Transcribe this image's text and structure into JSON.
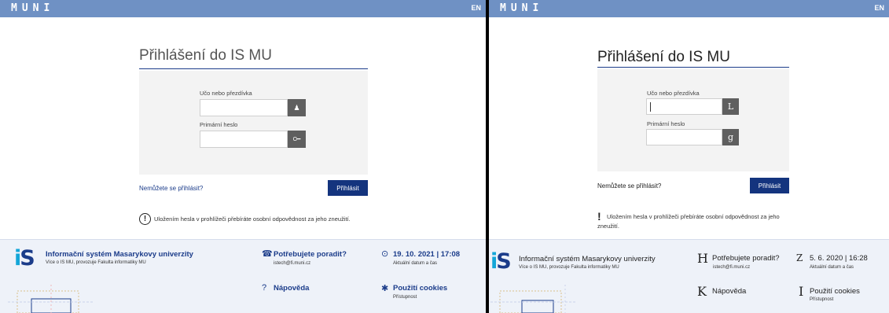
{
  "left": {
    "logo": "MUNI",
    "lang": "EN",
    "title": "Přihlášení do IS MU",
    "uco_label": "Učo nebo přezdívka",
    "uco_value": "",
    "uco_icon": "user-icon",
    "uco_icon_glyph": "♟",
    "password_label": "Primární heslo",
    "password_value": "",
    "password_icon": "key-icon",
    "password_icon_glyph": "O━",
    "cant_login": "Nemůžete se přihlásit?",
    "submit": "Přihlásit",
    "warning_icon": "exclamation-circle-icon",
    "warning_icon_glyph": "!",
    "warning": "Uložením hesla v prohlížeči přebíráte osobní odpovědnost za jeho zneužití.",
    "footer": {
      "system_title": "Informační systém Masarykovy univerzity",
      "system_sub": "Více o IS MU, provozuje Fakulta informatiky MU",
      "help_icon": "phone-icon",
      "help_icon_glyph": "☎",
      "help_title": "Potřebujete poradit?",
      "help_email": "istech@fi.muni.cz",
      "clock_icon": "clock-icon",
      "clock_icon_glyph": "⊙",
      "datetime": "19. 10. 2021  |  17:08",
      "datetime_sub": "Aktuální datum a čas",
      "manual_icon": "question-circle-icon",
      "manual_icon_glyph": "?",
      "manual": "Nápověda",
      "cookies_icon": "gear-icon",
      "cookies_icon_glyph": "✱",
      "cookies": "Použití cookies",
      "accessibility": "Přístupnost"
    }
  },
  "right": {
    "logo": "MUNI",
    "lang": "EN",
    "title": "Přihlášení do IS MU",
    "uco_label": "Učo nebo přezdívka",
    "uco_value": "",
    "uco_icon": "user-icon",
    "uco_icon_glyph": "L",
    "password_label": "Primární heslo",
    "password_value": "",
    "password_icon": "key-icon",
    "password_icon_glyph": "g",
    "cant_login": "Nemůžete se přihlásit?",
    "submit": "Přihlásit",
    "warning_icon": "exclamation-icon",
    "warning_icon_glyph": "!",
    "warning": "Uložením hesla v prohlížeči přebíráte osobní odpovědnost za jeho zneužití.",
    "footer": {
      "system_title": "Informační systém Masarykovy univerzity",
      "system_sub": "Více o IS MU, provozuje Fakulta informatiky MU",
      "help_icon": "phone-icon",
      "help_icon_glyph": "H",
      "help_title": "Potřebujete poradit?",
      "help_email": "istech@fi.muni.cz",
      "clock_icon": "clock-icon",
      "clock_icon_glyph": "Z",
      "datetime": "5. 6. 2020  |  16:28",
      "datetime_sub": "Aktuální datum a čas",
      "manual_icon": "question-circle-icon",
      "manual_icon_glyph": "K",
      "manual": "Nápověda",
      "cookies_icon": "gear-icon",
      "cookies_icon_glyph": "I",
      "cookies": "Použití cookies",
      "accessibility": "Přístupnost"
    }
  }
}
